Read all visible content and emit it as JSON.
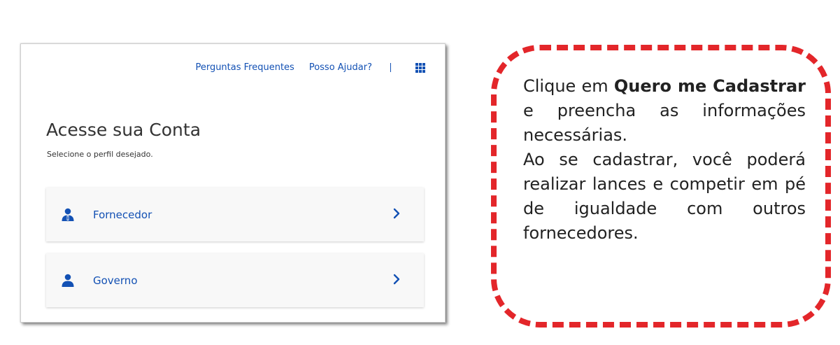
{
  "header": {
    "faq_link": "Perguntas Frequentes",
    "help_link": "Posso Ajudar?",
    "apps_icon": "grid-icon"
  },
  "login": {
    "title": "Acesse sua Conta",
    "subtitle": "Selecione o perfil desejado.",
    "profiles": [
      {
        "label": "Fornecedor",
        "icon": "supplier-user-icon"
      },
      {
        "label": "Governo",
        "icon": "user-icon"
      }
    ]
  },
  "callout": {
    "part1": "Clique em ",
    "bold1": "Quero me Cadastrar",
    "part2": " e preencha as informações necessárias.",
    "part3": "Ao se cadastrar, você poderá realizar lances e competir em pé de igualdade com outros fornecedores."
  },
  "colors": {
    "link_blue": "#1351b4",
    "callout_border": "#e3262a",
    "card_bg": "#f8f8f8"
  }
}
